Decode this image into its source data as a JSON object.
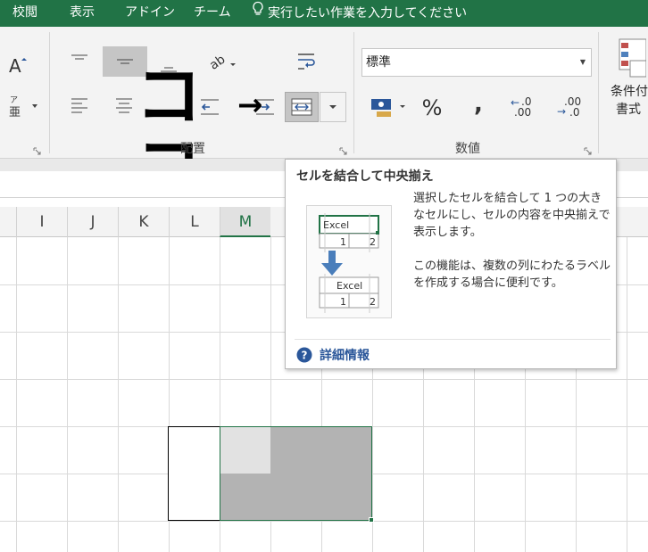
{
  "tabs": [
    {
      "label": "校閲"
    },
    {
      "label": "表示"
    },
    {
      "label": "アドイン"
    },
    {
      "label": "チーム"
    }
  ],
  "tell_me": {
    "label": "実行したい作業を入力してください"
  },
  "ribbon": {
    "font_group": {
      "phonetic_label": "ア亜"
    },
    "alignment_group": {
      "label": "配置"
    },
    "number_group": {
      "label": "数値",
      "format_value": "標準",
      "percent_label": "%",
      "comma_label": ",",
      "increase_decimal_top": ".0",
      "increase_decimal_bottom": ".00",
      "decrease_decimal_top": ".00",
      "decrease_decimal_bottom": ".0"
    },
    "styles_group": {
      "conditional_label_line1": "条件付",
      "conditional_label_line2": "書式"
    }
  },
  "annotation": {
    "text": "ココ",
    "arrow": "→"
  },
  "columns": [
    {
      "label": "I",
      "selected": false
    },
    {
      "label": "J",
      "selected": false
    },
    {
      "label": "K",
      "selected": false
    },
    {
      "label": "L",
      "selected": false
    },
    {
      "label": "M",
      "selected": true
    }
  ],
  "tooltip": {
    "title": "セルを結合して中央揃え",
    "description_1": "選択したセルを結合して 1 つの大きなセルにし、セルの内容を中央揃えで表示します。",
    "description_2": "この機能は、複数の列にわたるラベルを作成する場合に便利です。",
    "illustration": {
      "before_text": "Excel",
      "before_num_1": "1",
      "before_num_2": "2",
      "after_text": "Excel",
      "after_num_1": "1",
      "after_num_2": "2"
    },
    "more_info": "詳細情報"
  },
  "colors": {
    "accent": "#217346",
    "ribbon_bg": "#f3f3f3",
    "link": "#2b579a",
    "selection_fill": "#b3b3b3",
    "active_cell": "#e2e2e2"
  }
}
